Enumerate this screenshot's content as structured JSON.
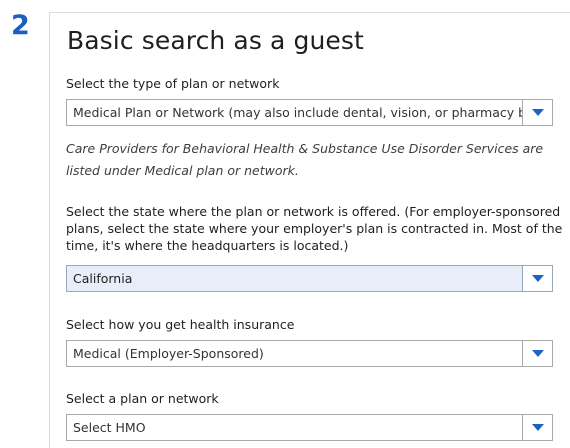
{
  "step_number": "2",
  "title": "Basic search as a guest",
  "fields": {
    "plan_type": {
      "label": "Select the type of plan or network",
      "value": "Medical Plan or Network (may also include dental, vision, or pharmacy benefits)"
    },
    "note": "Care Providers for Behavioral Health & Substance Use Disorder Services are listed under Medical plan or network.",
    "state": {
      "label": "Select the state where the plan or network is offered. (For employer-sponsored plans, select the state where your employer's plan is contracted in. Most of the time, it's where the headquarters is located.)",
      "value": "California"
    },
    "insurance_source": {
      "label": "Select how you get health insurance",
      "value": "Medical (Employer-Sponsored)"
    },
    "plan": {
      "label": "Select a plan or network",
      "value": "Select HMO"
    }
  },
  "colors": {
    "accent": "#1c5fc4",
    "caret": "#1c63c6",
    "filled_bg": "#e8eef9"
  },
  "icons": {
    "dropdown": "chevron-down-icon"
  }
}
